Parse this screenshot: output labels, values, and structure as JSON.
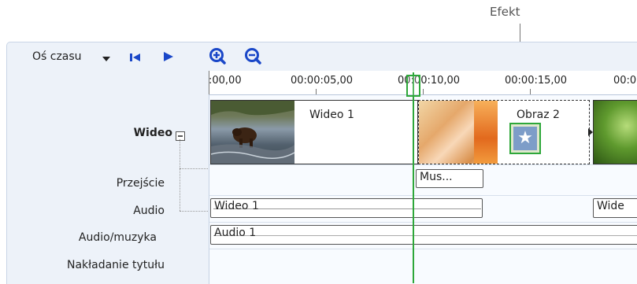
{
  "callout": {
    "effect_label": "Efekt"
  },
  "toolbar": {
    "timeline_label": "Oś czasu",
    "dropdown_icon": "triangle-down",
    "prev_icon": "skip-to-start",
    "play_icon": "play",
    "zoom_in_icon": "magnifier-plus",
    "zoom_out_icon": "magnifier-minus"
  },
  "ruler": {
    "labels": [
      ":00,00",
      "00:00:05,00",
      "00:00:10,00",
      "00:00:15,00",
      "00:0"
    ]
  },
  "tracks": {
    "video": "Wideo",
    "collapse_icon": "minus-box",
    "transition": "Przejście",
    "audio": "Audio",
    "audio_music": "Audio/muzyka",
    "title_overlay": "Nakładanie tytułu"
  },
  "clips": {
    "video1": "Wideo 1",
    "image2": "Obraz 2",
    "transition_clip": "Mus...",
    "audio_video1": "Wideo 1",
    "audio_video_cut": "Wide",
    "audio1": "Audio 1"
  },
  "colors": {
    "accent_blue": "#1a47c8",
    "playhead_green": "#2ea73a",
    "panel_bg": "#edf2f9"
  }
}
